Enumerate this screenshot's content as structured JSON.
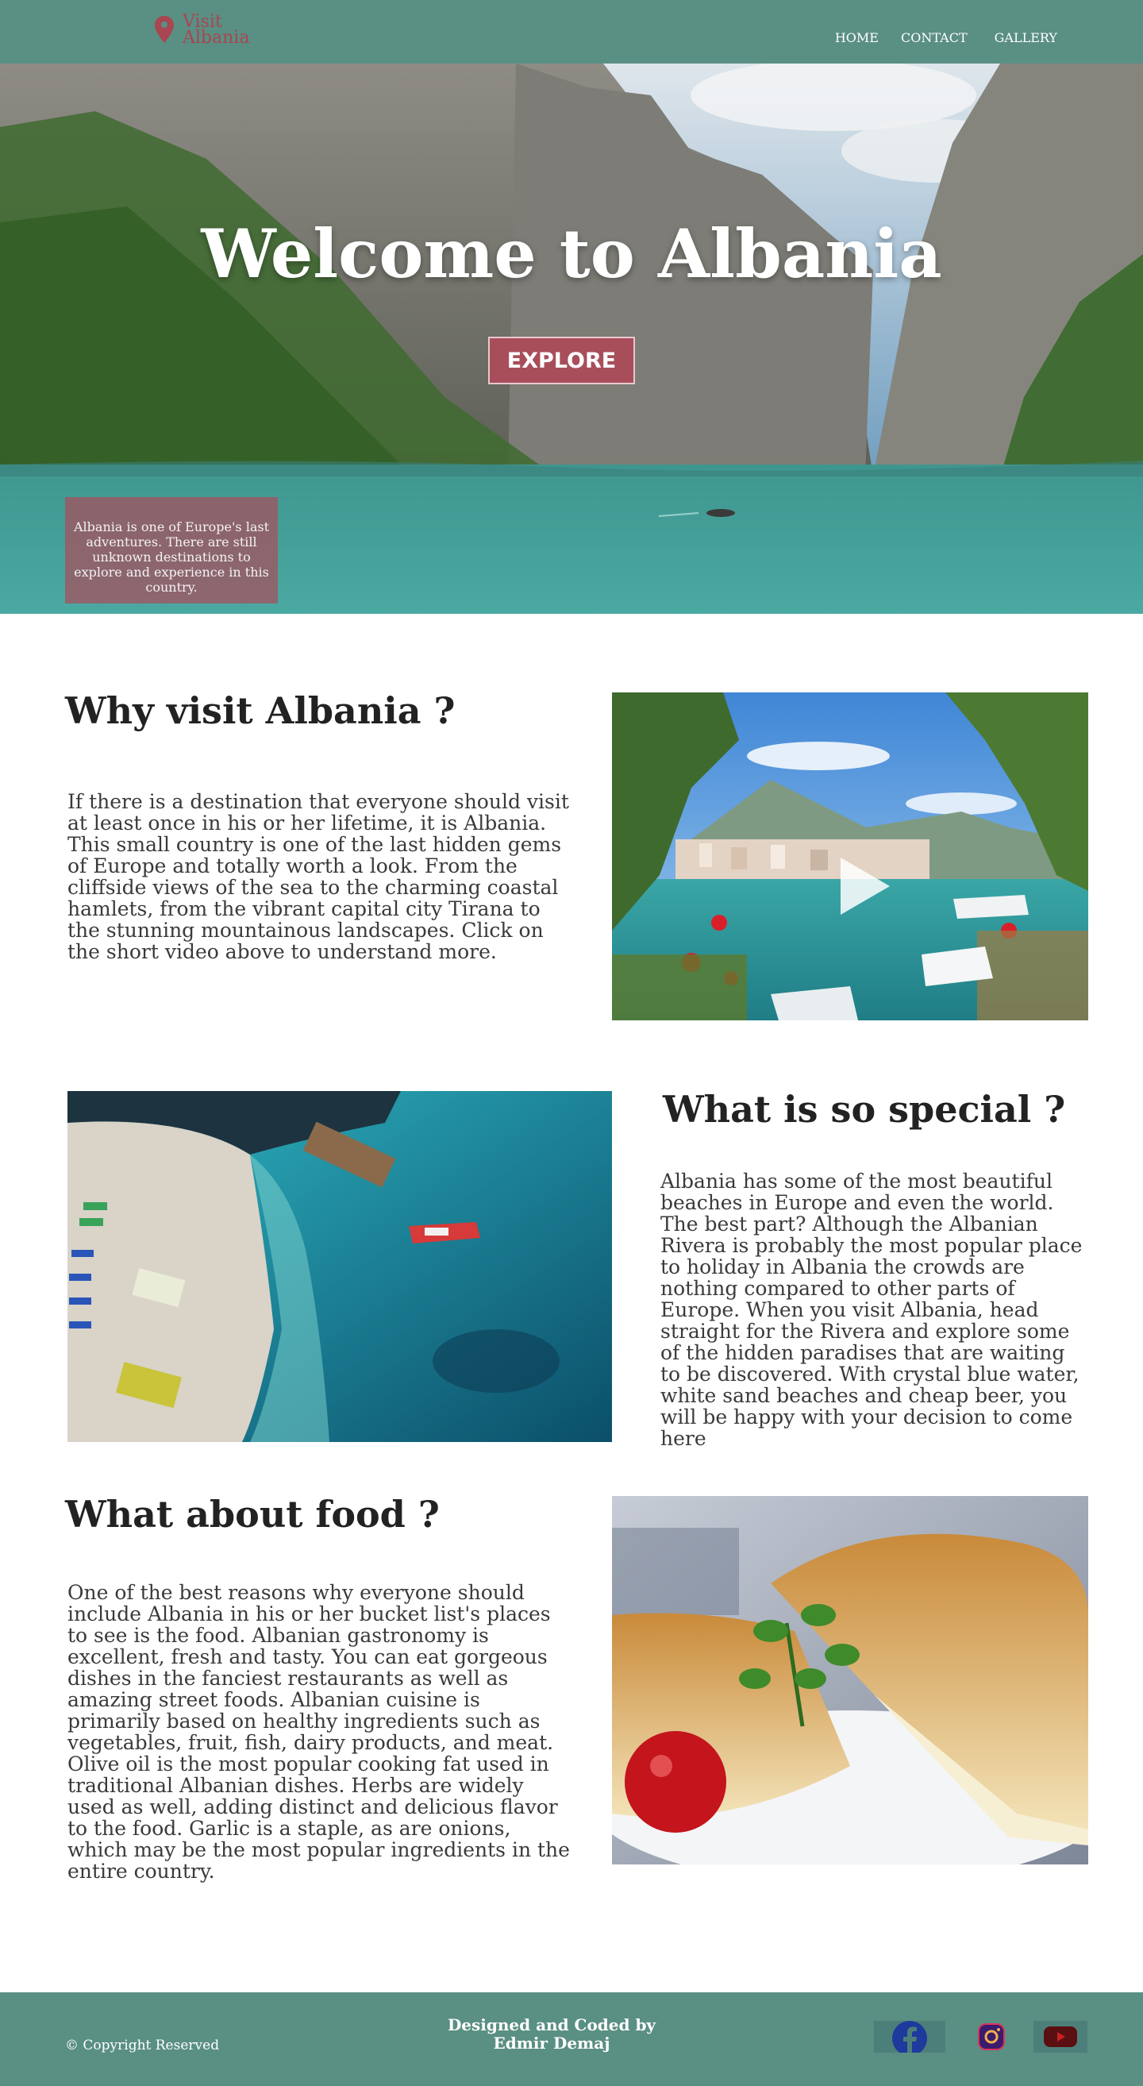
{
  "nav": {
    "logo_line1": "Visit",
    "logo_line2": "Albania",
    "links": [
      "HOME",
      "CONTACT",
      "GALLERY"
    ]
  },
  "hero": {
    "title": "Welcome to Albania",
    "button": "EXPLORE",
    "note": "Albania is one of Europe's last adventures. There are still unknown destinations to explore and experience in this country."
  },
  "sections": [
    {
      "heading": "Why visit Albania ?",
      "text": "If there is a destination that everyone should visit at least once in his or her lifetime, it is Albania. This small country is one of the last hidden gems of Europe and totally worth a look. From the cliffside views of the sea to the charming coastal hamlets, from the vibrant capital city Tirana to the stunning mountainous landscapes. Click on the short video above to understand more."
    },
    {
      "heading": "What is so special ?",
      "text": "Albania has some of the most beautiful beaches in Europe and even the world. The best part?  Although the Albanian Rivera is probably the most popular place to holiday in Albania the crowds are nothing compared to other parts of Europe.  When you visit Albania, head straight for the Rivera and explore some of the hidden paradises that are waiting to be discovered.  With crystal blue water, white sand beaches and cheap beer, you will be happy with your decision to come here"
    },
    {
      "heading": "What about food ?",
      "text": "One of the best reasons why everyone should include Albania in his or her bucket list's places to see is the food. Albanian gastronomy is excellent, fresh and tasty. You can eat gorgeous dishes in the fanciest restaurants as well as amazing street foods. Albanian cuisine is primarily based on healthy ingredients such as vegetables, fruit, fish, dairy products, and meat. Olive oil is the most popular cooking fat used in traditional Albanian dishes. Herbs are widely used as well, adding distinct and delicious flavor to the food. Garlic is a staple, as are onions, which may be the most popular ingredients in the entire country."
    }
  ],
  "footer": {
    "copyright": "© Copyright Reserved",
    "credit_line1": "Designed and Coded by",
    "credit_line2": "Edmir Demaj",
    "social": [
      "facebook-icon",
      "instagram-icon",
      "youtube-icon"
    ]
  },
  "colors": {
    "nav_bg": "#5a8f83",
    "accent": "#a84e5b",
    "text": "#2a2a2a"
  }
}
